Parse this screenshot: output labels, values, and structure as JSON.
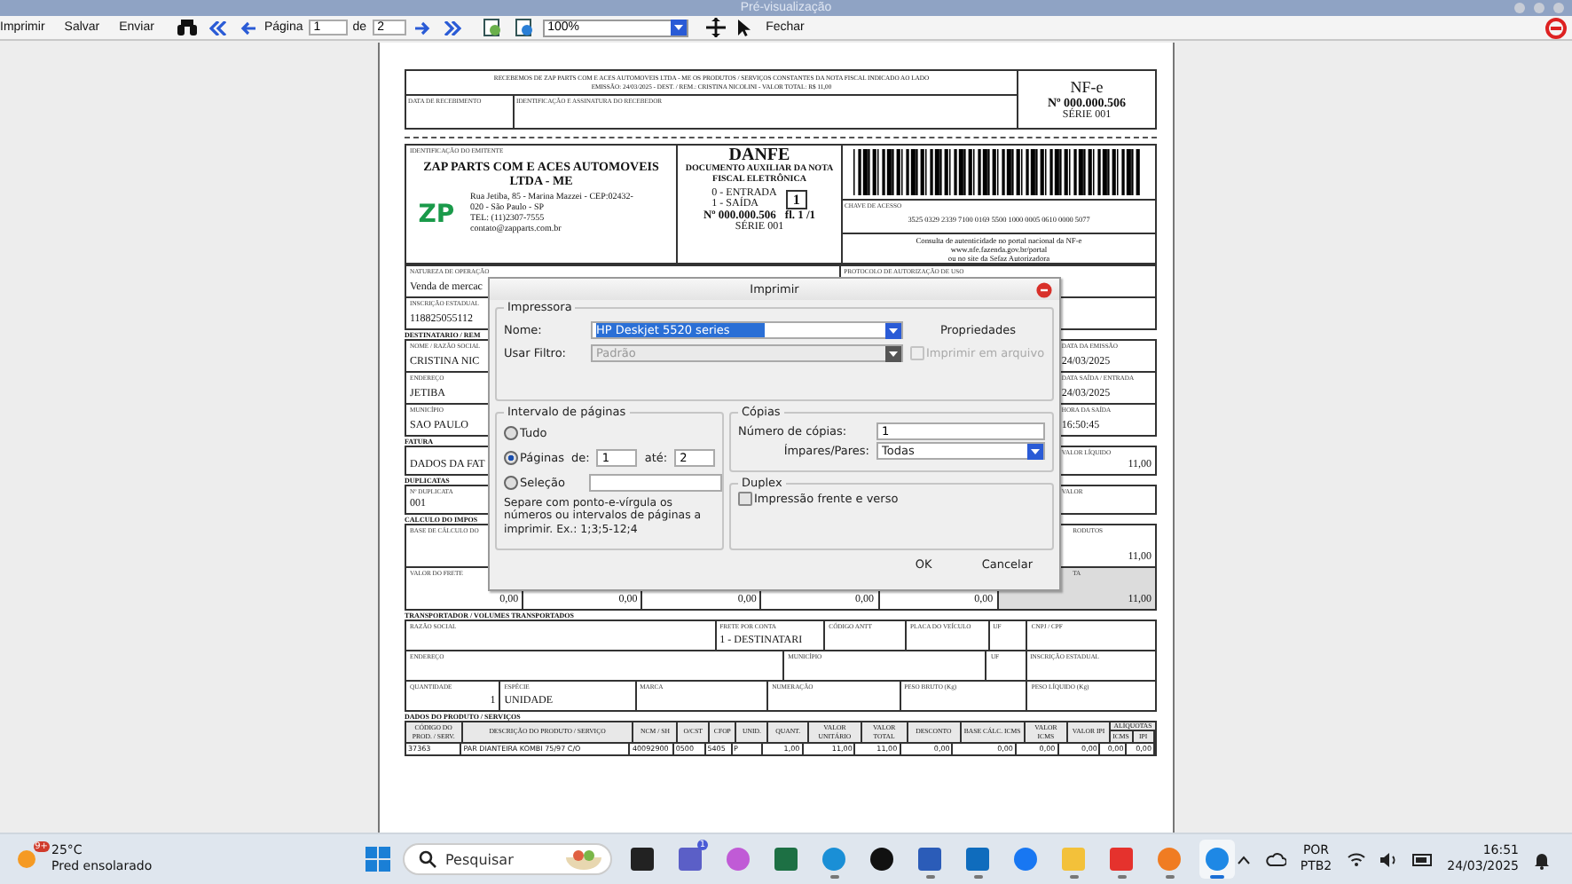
{
  "window": {
    "title": "Pré-visualização"
  },
  "toolbar": {
    "buttons": [
      "Imprimir",
      "Salvar",
      "Enviar"
    ],
    "page_label": "Página",
    "page_value": "1",
    "of_label": "de",
    "page_total": "2",
    "zoom": "100%",
    "close": "Fechar"
  },
  "document": {
    "receipt": {
      "lines": [
        "RECEBEMOS DE ZAP PARTS COM E ACES AUTOMOVEIS LTDA - ME OS PRODUTOS / SERVIÇOS CONSTANTES DA NOTA FISCAL INDICADO AO LADO",
        "EMISSÃO: 24/03/2025 - DEST. / REM.: CRISTINA NICOLINI - VALOR TOTAL: R$ 11,00"
      ],
      "date_label": "DATA DE RECEBIMENTO",
      "sign_label": "IDENTIFICAÇÃO E ASSINATURA DO RECEBEDOR"
    },
    "nfe_box": {
      "title": "NF-e",
      "number": "Nº 000.000.506",
      "series": "SÉRIE 001"
    },
    "emitter": {
      "label": "IDENTIFICAÇÃO DO EMITENTE",
      "name": "ZAP PARTS COM E ACES AUTOMOVEIS LTDA - ME",
      "logo": "ZP",
      "address_lines": [
        "Rua Jetiba, 85 - Marina Mazzei - CEP:02432-",
        "020 - São Paulo - SP",
        "TEL: (11)2307-7555",
        "contato@zapparts.com.br"
      ]
    },
    "danfe": {
      "title": "DANFE",
      "subtitle": "DOCUMENTO AUXILIAR DA NOTA FISCAL ELETRÔNICA",
      "entry": "0 - ENTRADA",
      "exit": "1 - SAÍDA",
      "type": "1",
      "number": "Nº 000.000.506",
      "sheet": "fl. 1 /1",
      "series": "SÉRIE 001"
    },
    "access": {
      "label": "CHAVE DE ACESSO",
      "key": "3525 0329 2339 7100 0169 5500 1000 0005 0610 0000 5077",
      "consult_lines": [
        "Consulta de autenticidade no portal nacional da NF-e",
        "www.nfe.fazenda.gov.br/portal",
        "ou no site da Sefaz Autorizadora"
      ]
    },
    "sections": [
      {
        "rows": [
          {
            "cells": [
              {
                "kind": "text",
                "label": "NATUREZA DE OPERAÇÃO",
                "value": "Venda de mercac"
              },
              {
                "kind": "text",
                "label": "PROTOCOLO DE AUTORIZAÇÃO DE USO"
              }
            ]
          },
          {
            "cells": [
              {
                "kind": "text",
                "label": "INSCRIÇÃO ESTADUAL",
                "value": "118825055112"
              }
            ]
          }
        ]
      },
      {
        "heading": "DESTINATARIO / REM",
        "rows": [
          {
            "cells": [
              {
                "kind": "text",
                "label": "NOME / RAZÃO SOCIAL",
                "value": "CRISTINA NIC"
              },
              {
                "kind": "text",
                "label": "DATA DA EMISSÃO",
                "value": "24/03/2025"
              }
            ]
          },
          {
            "cells": [
              {
                "kind": "text",
                "label": "ENDEREÇO",
                "value": "JETIBA"
              },
              {
                "kind": "text",
                "label": "DATA SAÍDA / ENTRADA",
                "value": "24/03/2025"
              }
            ]
          },
          {
            "cells": [
              {
                "kind": "text",
                "label": "MUNICÍPIO",
                "value": "SAO PAULO"
              },
              {
                "kind": "text",
                "label": "HORA DA SAÍDA",
                "value": "16:50:45"
              }
            ]
          }
        ]
      },
      {
        "heading": "FATURA",
        "rows": [
          {
            "cells": [
              {
                "kind": "text",
                "value": "DADOS DA FAT"
              },
              {
                "kind": "number",
                "label": "VALOR LÍQUIDO",
                "value": "11,00"
              }
            ]
          }
        ]
      },
      {
        "heading": "DUPLICATAS",
        "rows": [
          {
            "cells": [
              {
                "kind": "text",
                "label": "Nº DUPLICATA",
                "value": "001"
              },
              {
                "kind": "number",
                "label": "VALOR"
              }
            ]
          }
        ]
      },
      {
        "heading": "CALCULO DO IMPOS",
        "rows": [
          {
            "cells": [
              {
                "kind": "text",
                "label": "BASE DE CÁLCULO DO"
              },
              {
                "kind": "number"
              },
              {
                "kind": "number"
              },
              {
                "kind": "number"
              },
              {
                "kind": "number"
              },
              {
                "kind": "number",
                "label": "RODUTOS",
                "value": "11,00"
              }
            ]
          },
          {
            "cells": [
              {
                "kind": "number",
                "label": "VALOR DO FRETE",
                "value": "0,00"
              },
              {
                "kind": "number",
                "value": "0,00"
              },
              {
                "kind": "number",
                "value": "0,00"
              },
              {
                "kind": "number",
                "value": "0,00"
              },
              {
                "kind": "number",
                "value": "0,00"
              },
              {
                "kind": "total",
                "label": "TA",
                "value": "11,00"
              }
            ]
          }
        ]
      },
      {
        "heading": "TRANSPORTADOR / VOLUMES TRANSPORTADOS",
        "rows": [
          {
            "cells": [
              {
                "kind": "text",
                "label": "RAZÃO SOCIAL"
              },
              {
                "kind": "text",
                "label": "FRETE POR CONTA",
                "value": "1 - DESTINATARI"
              },
              {
                "kind": "text",
                "label": "CÓDIGO ANTT"
              },
              {
                "kind": "text",
                "label": "PLACA DO VEÍCULO"
              },
              {
                "kind": "text",
                "label": "UF"
              },
              {
                "kind": "text",
                "label": "CNPJ / CPF"
              }
            ]
          }
        ]
      },
      {
        "rows": [
          {
            "cells": [
              {
                "kind": "text",
                "label": "ENDEREÇO"
              },
              {
                "kind": "text",
                "label": "MUNICÍPIO"
              },
              {
                "kind": "text",
                "label": "UF"
              },
              {
                "kind": "text",
                "label": "INSCRIÇÃO ESTADUAL"
              }
            ]
          }
        ]
      },
      {
        "rows": [
          {
            "cells": [
              {
                "kind": "number",
                "label": "QUANTIDADE",
                "value": "1"
              },
              {
                "kind": "text",
                "label": "ESPÉCIE",
                "value": "UNIDADE"
              },
              {
                "kind": "text",
                "label": "MARCA"
              },
              {
                "kind": "text",
                "label": "NUMERAÇÃO"
              },
              {
                "kind": "text",
                "label": "PESO BRUTO (Kg)"
              },
              {
                "kind": "text",
                "label": "PESO LÍQUIDO (Kg)"
              }
            ]
          }
        ]
      }
    ],
    "products": {
      "heading": "DADOS DO PRODUTO / SERVIÇOS",
      "columns": [
        "CÓDIGO DO PROD. / SERV.",
        "DESCRIÇÃO DO PRODUTO / SERVIÇO",
        "NCM / SH",
        "O/CST",
        "CFOP",
        "UNID.",
        "QUANT.",
        "VALOR UNITÁRIO",
        "VALOR TOTAL",
        "DESCONTO",
        "BASE CÁLC. ICMS",
        "VALOR ICMS",
        "VALOR IPI",
        "ICMS",
        "IPI"
      ],
      "rates_label": "ALÍQUOTAS",
      "rows": [
        [
          "37363",
          "PAR DIANTEIRA KOMBI 75/97 C/O",
          "40092900",
          "0500",
          "5405",
          "P",
          "1,00",
          "11,00",
          "11,00",
          "0,00",
          "0,00",
          "0,00",
          "0,00",
          "0,00",
          "0,00"
        ]
      ]
    }
  },
  "dialog": {
    "title": "Imprimir",
    "printer": {
      "group": "Impressora",
      "name_label": "Nome:",
      "name_value": "HP Deskjet 5520 series",
      "properties": "Propriedades",
      "filter_label": "Usar Filtro:",
      "filter_value": "Padrão",
      "filter_disabled": true,
      "to_file": {
        "label": "Imprimir em arquivo",
        "checked": false,
        "disabled": true
      }
    },
    "range": {
      "group": "Intervalo de páginas",
      "options": [
        {
          "label": "Tudo",
          "selected": false
        },
        {
          "label": "Páginas",
          "selected": true
        },
        {
          "label": "Seleção",
          "selected": false
        }
      ],
      "from_label": "de:",
      "from_value": "1",
      "to_label": "até:",
      "to_value": "2",
      "hint": "Separe com ponto-e-vírgula os números ou intervalos de páginas a imprimir. Ex.: 1;3;5-12;4"
    },
    "copies": {
      "group": "Cópias",
      "count_label": "Número de cópias:",
      "count_value": "1",
      "parity_label": "Ímpares/Pares:",
      "parity_value": "Todas"
    },
    "duplex": {
      "group": "Duplex",
      "label": "Impressão frente e verso",
      "checked": false
    },
    "buttons": [
      "OK",
      "Cancelar"
    ]
  },
  "taskbar": {
    "weather": {
      "badge": "9+",
      "temp": "25°C",
      "desc": "Pred ensolarado"
    },
    "search_placeholder": "Pesquisar",
    "apps": [
      {
        "kind": "taskview",
        "running": false,
        "active": false
      },
      {
        "kind": "teams",
        "badge": "1",
        "running": false,
        "active": false
      },
      {
        "kind": "copilot",
        "running": false,
        "active": false
      },
      {
        "kind": "excel",
        "running": false,
        "active": false
      },
      {
        "kind": "edge",
        "running": true,
        "active": false
      },
      {
        "kind": "dell",
        "running": false,
        "active": false
      },
      {
        "kind": "word",
        "running": true,
        "active": false
      },
      {
        "kind": "outlook",
        "running": true,
        "active": false
      },
      {
        "kind": "facebook",
        "running": false,
        "active": false
      },
      {
        "kind": "folder",
        "running": true,
        "active": false
      },
      {
        "kind": "anydesk",
        "running": true,
        "active": false
      },
      {
        "kind": "sync",
        "running": true,
        "active": false
      },
      {
        "kind": "it",
        "running": true,
        "active": true
      }
    ],
    "lang": [
      "POR",
      "PTB2"
    ],
    "time": "16:51",
    "date": "24/03/2025"
  }
}
